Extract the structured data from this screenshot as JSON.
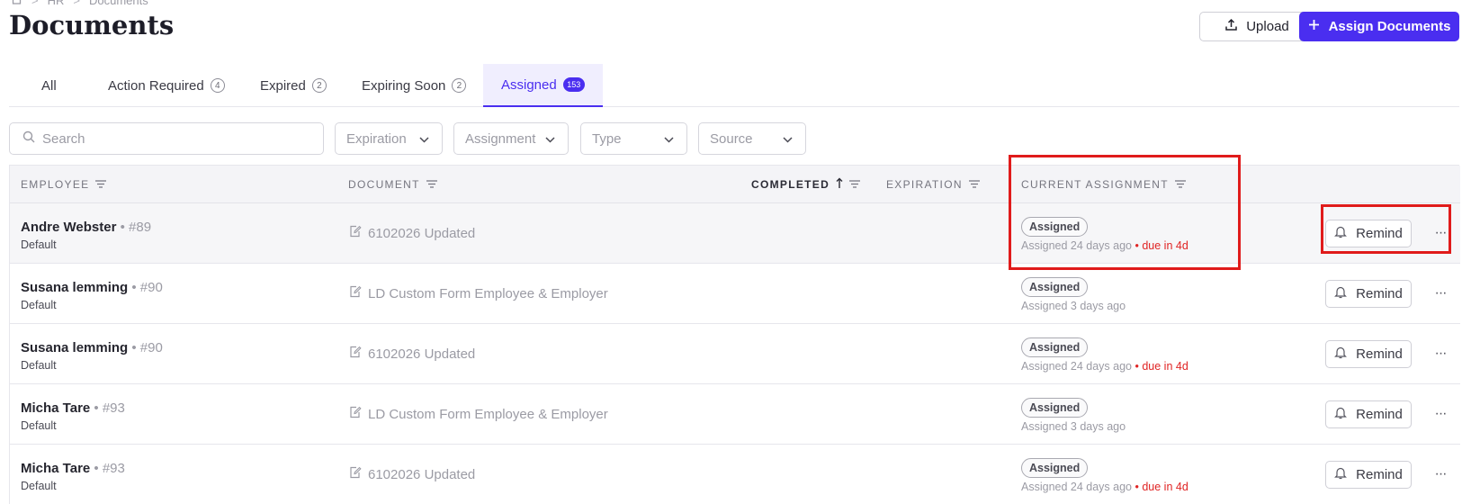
{
  "breadcrumb": {
    "home_icon": "home-icon",
    "items": [
      "HR",
      "Documents"
    ],
    "separator": ">"
  },
  "page": {
    "title": "Documents"
  },
  "header": {
    "upload_label": "Upload",
    "assign_label": "Assign Documents",
    "assign_color": "#4a2ef0"
  },
  "tabs": [
    {
      "label": "All",
      "count": null
    },
    {
      "label": "Action Required",
      "count": "4"
    },
    {
      "label": "Expired",
      "count": "2"
    },
    {
      "label": "Expiring Soon",
      "count": "2"
    },
    {
      "label": "Assigned",
      "count": "153",
      "active": true
    }
  ],
  "filters": {
    "search_placeholder": "Search",
    "expiration": "Expiration",
    "assignment": "Assignment",
    "type": "Type",
    "source": "Source"
  },
  "table": {
    "columns": {
      "employee": "Employee",
      "document": "Document",
      "completed": "Completed",
      "expiration": "Expiration",
      "current_assignment": "Current Assignment"
    },
    "rows": [
      {
        "name": "Andre Webster",
        "id": "• #89",
        "group": "Default",
        "document": "6102026 Updated",
        "status": "Assigned",
        "assigned": "Assigned 24 days ago",
        "due": "• due in 4d",
        "remind": "Remind"
      },
      {
        "name": "Susana lemming",
        "id": "• #90",
        "group": "Default",
        "document": "LD Custom Form Employee & Employer",
        "status": "Assigned",
        "assigned": "Assigned 3 days ago",
        "due": "",
        "remind": "Remind"
      },
      {
        "name": "Susana lemming",
        "id": "• #90",
        "group": "Default",
        "document": "6102026 Updated",
        "status": "Assigned",
        "assigned": "Assigned 24 days ago",
        "due": "• due in 4d",
        "remind": "Remind"
      },
      {
        "name": "Micha Tare",
        "id": "• #93",
        "group": "Default",
        "document": "LD Custom Form Employee & Employer",
        "status": "Assigned",
        "assigned": "Assigned 3 days ago",
        "due": "",
        "remind": "Remind"
      },
      {
        "name": "Micha Tare",
        "id": "• #93",
        "group": "Default",
        "document": "6102026 Updated",
        "status": "Assigned",
        "assigned": "Assigned 24 days ago",
        "due": "• due in 4d",
        "remind": "Remind"
      }
    ]
  },
  "colors": {
    "accent": "#4a2ef0",
    "due": "#e02424",
    "highlight": "#e01b1b"
  }
}
